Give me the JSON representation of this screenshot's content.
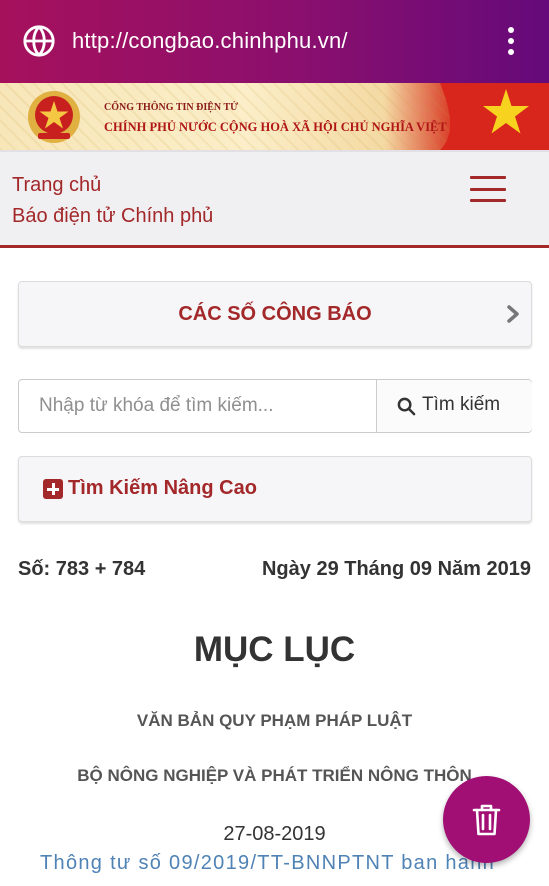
{
  "browser": {
    "url": "http://congbao.chinhphu.vn/",
    "icons": {
      "site": "globe-icon",
      "menu": "more-vert-icon"
    }
  },
  "banner": {
    "line1": "CỔNG THÔNG TIN ĐIỆN TỬ",
    "line2": "CHÍNH PHỦ NƯỚC CỘNG HOÀ XÃ HỘI CHỦ NGHĨA VIỆT NAM",
    "icons": {
      "emblem": "national-emblem-icon",
      "flag": "vietnam-flag-icon"
    }
  },
  "nav": {
    "home": "Trang chủ",
    "news": "Báo điện tử Chính phủ",
    "menu_icon": "hamburger-menu-icon"
  },
  "issues_button": {
    "label": "CÁC SỐ CÔNG BÁO",
    "icon": "chevron-right-icon"
  },
  "search": {
    "placeholder": "Nhập từ khóa để tìm kiếm...",
    "value": "",
    "button_label": "Tìm kiếm",
    "icon": "search-icon"
  },
  "advanced_search": {
    "label": "Tìm Kiếm Nâng Cao",
    "icon": "plus-square-icon"
  },
  "issue": {
    "number": "Số: 783 + 784",
    "date": "Ngày 29 Tháng 09 Năm 2019"
  },
  "content": {
    "toc_title": "MỤC LỤC",
    "section_type": "VĂN BẢN QUY PHẠM PHÁP LUẬT",
    "agency": "BỘ NÔNG NGHIỆP VÀ PHÁT TRIỂN NÔNG THÔN",
    "doc_date": "27-08-2019",
    "doc_link": "Thông tư số 09/2019/TT-BNNPTNT ban hành"
  },
  "fab": {
    "icon": "trash-icon"
  },
  "colors": {
    "brand_red": "#a3282a",
    "url_bar": "#8a0f6e",
    "fab": "#a10f75",
    "link": "#4f82b5"
  }
}
